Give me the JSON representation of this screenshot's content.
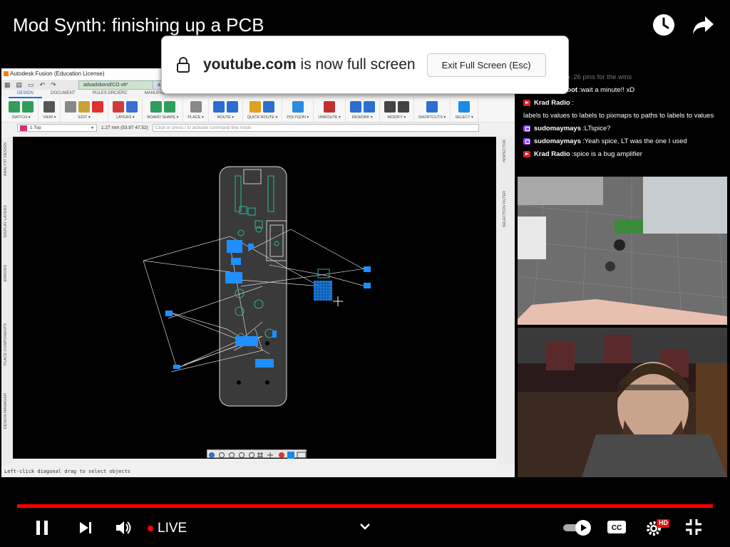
{
  "video": {
    "title": "Mod Synth: finishing up a PCB"
  },
  "top_icons": {
    "watch_later": "clock-icon",
    "share": "share-arrow-icon"
  },
  "fullscreen_toast": {
    "site": "youtube.com",
    "message": "is now full screen",
    "exit_button": "Exit Full Screen (Esc)"
  },
  "fusion": {
    "window_title": "Autodesk Fusion (Education License)",
    "doc_tabs": [
      "adsadsbond/CO v8*",
      "a"
    ],
    "workspace_tabs": [
      "DESIGN",
      "DOCUMENT",
      "RULES DRC/ERC",
      "MANUFACTURING",
      "AUTOMATION",
      "SIMULATION",
      "LIBRARY"
    ],
    "toolbar_groups": [
      {
        "label": "SWITCH ▾",
        "colors": [
          "#2e9e5a",
          "#2e9e5a"
        ]
      },
      {
        "label": "VIEW ▾",
        "colors": [
          "#555"
        ]
      },
      {
        "label": "EDIT ▾",
        "colors": [
          "#888",
          "#c9a23a",
          "#e03030"
        ]
      },
      {
        "label": "LAYERS ▾",
        "colors": [
          "#d23a3a",
          "#3a6fd2"
        ]
      },
      {
        "label": "BOARD SHAPE ▾",
        "colors": [
          "#2e9e5a",
          "#2e9e5a"
        ]
      },
      {
        "label": "PLACE ▾",
        "colors": [
          "#888"
        ]
      },
      {
        "label": "ROUTE ▾",
        "colors": [
          "#2a6fd1",
          "#2a6fd1"
        ]
      },
      {
        "label": "QUICK ROUTE ▾",
        "colors": [
          "#e0a020",
          "#2a6fd1"
        ]
      },
      {
        "label": "POLYGON ▾",
        "colors": [
          "#2a8be0"
        ]
      },
      {
        "label": "UNROUTE ▾",
        "colors": [
          "#c03030"
        ]
      },
      {
        "label": "REWORK ▾",
        "colors": [
          "#2a6fd1",
          "#2a6fd1"
        ]
      },
      {
        "label": "MODIFY ▾",
        "colors": [
          "#444",
          "#444"
        ]
      },
      {
        "label": "SHORTCUTS ▾",
        "colors": [
          "#2a6fd1"
        ]
      },
      {
        "label": "SELECT ▾",
        "colors": [
          "#1a8be6"
        ]
      }
    ],
    "layer_selector": "1 Top",
    "coordinates": "1.27 mm (53.97 47.52)",
    "command_placeholder": "Click or press / to activate command line mode",
    "left_panels": [
      "ANALYST DESIGN",
      "DISPLAY LAYERS",
      "ERRORS",
      "PLACE COMPONENTS",
      "DESIGN MANAGER"
    ],
    "right_panels": [
      "INSPECTOR",
      "SELECTION FILTER"
    ],
    "status": "Left-click diagonal drag to select objects"
  },
  "chat": [
    {
      "platform": "youtube",
      "author": "Krad Radio",
      "text": "26 pins for the wins",
      "faded": true
    },
    {
      "platform": "youtube",
      "author": "Wonky Robot",
      "text": "wait a minute!! xD",
      "faded": false
    },
    {
      "platform": "youtube",
      "author": "Krad Radio",
      "text": "labels to values to labels to pixmaps to paths to labels to values",
      "faded": false
    },
    {
      "platform": "twitch",
      "author": "sudomaymays",
      "text": "LTspice?",
      "faded": false
    },
    {
      "platform": "twitch",
      "author": "sudomaymays",
      "text": "Yeah spice, LT was the one I used",
      "faded": false
    },
    {
      "platform": "youtube",
      "author": "Krad Radio",
      "text": "spice is a bug amplifier",
      "faded": false
    }
  ],
  "player": {
    "progress": 1.0,
    "live_label": "LIVE",
    "hd_badge": "HD",
    "icons": [
      "pause-icon",
      "next-icon",
      "volume-icon",
      "chevron-down-icon",
      "autoplay-toggle-icon",
      "captions-icon",
      "settings-icon",
      "exit-fullscreen-icon"
    ],
    "colors": {
      "accent": "#ff0000"
    }
  }
}
